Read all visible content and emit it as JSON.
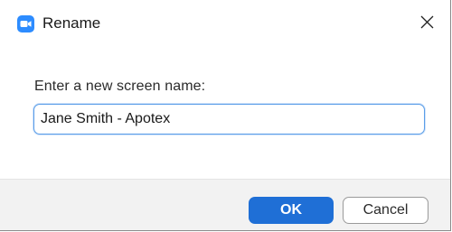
{
  "window": {
    "title": "Rename",
    "app_icon": "camera-icon",
    "close_icon": "close-icon"
  },
  "form": {
    "prompt": "Enter a new screen name:",
    "name_value": "Jane Smith - Apotex"
  },
  "buttons": {
    "ok_label": "OK",
    "cancel_label": "Cancel"
  },
  "colors": {
    "app_icon": "#2d8cff",
    "ok_button": "#1f6fd6",
    "input_focus_border": "#5b9ee8",
    "footer_background": "#f2f2f2"
  }
}
